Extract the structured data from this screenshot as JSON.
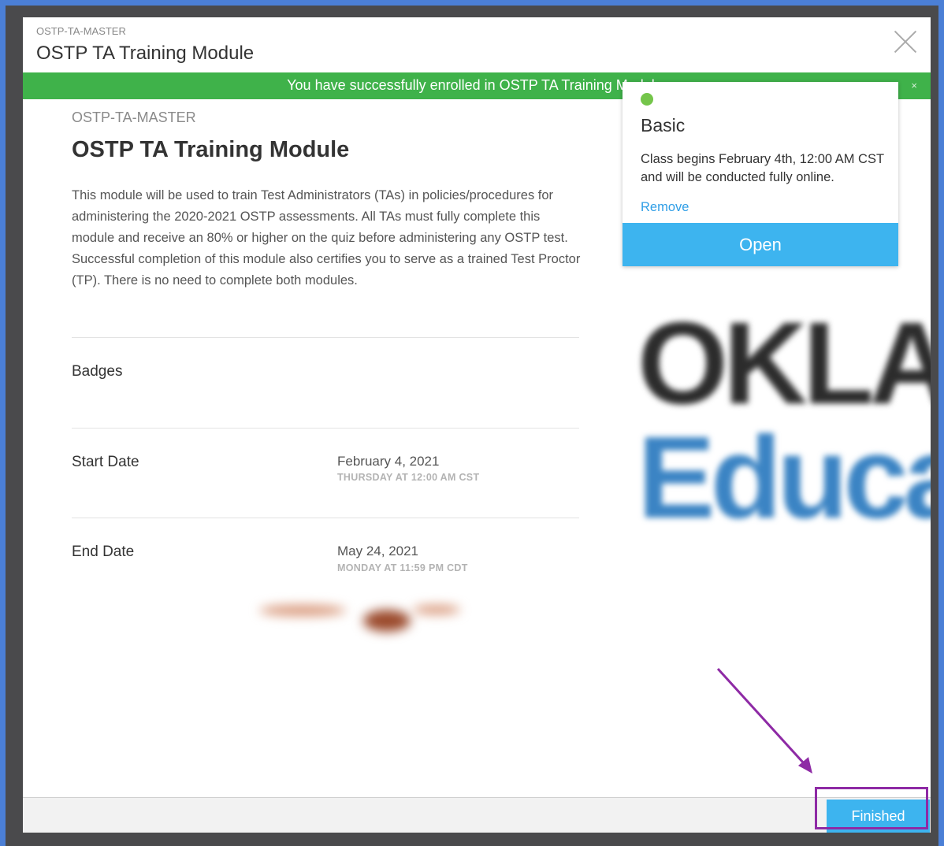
{
  "modal": {
    "header_code": "OSTP-TA-MASTER",
    "header_title": "OSTP TA Training Module"
  },
  "banner": {
    "message": "You have successfully enrolled in OSTP TA Training Module.",
    "close": "×"
  },
  "course": {
    "code": "OSTP-TA-MASTER",
    "title": "OSTP TA Training Module",
    "description": "This module will be used to train Test Administrators (TAs) in policies/procedures for administering the 2020-2021 OSTP assessments. All TAs must fully complete this module and receive an 80% or higher on the quiz before administering any OSTP test. Successful completion of this module also certifies you to serve as a trained Test Proctor (TP). There is no need to complete both modules."
  },
  "details": {
    "badges_label": "Badges",
    "start_label": "Start Date",
    "start_date": "February 4, 2021",
    "start_time": "THURSDAY AT 12:00 AM CST",
    "end_label": "End Date",
    "end_date": "May 24, 2021",
    "end_time": "MONDAY AT 11:59 PM CDT"
  },
  "card": {
    "title": "Basic",
    "text": "Class begins February 4th, 12:00 AM CST and will be conducted fully online.",
    "remove": "Remove",
    "open": "Open",
    "status_color": "#74c54a"
  },
  "logo": {
    "line1": "OKLA",
    "line2": "Educa"
  },
  "footer": {
    "finished": "Finished"
  },
  "annotation": {
    "color": "#8e2aa5"
  }
}
